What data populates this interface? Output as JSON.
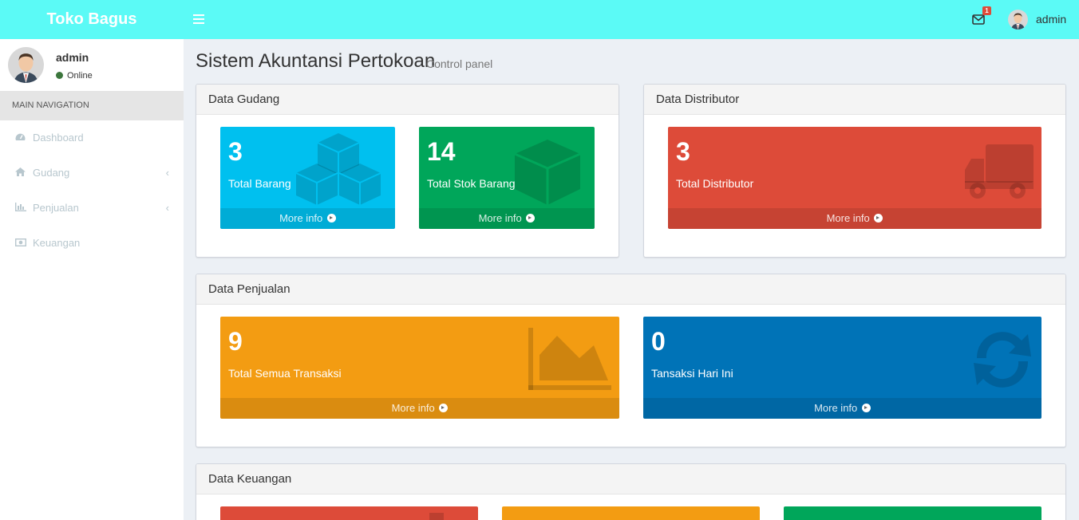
{
  "header": {
    "logo": "Toko Bagus",
    "mail_badge": "1",
    "username": "admin"
  },
  "sidebar": {
    "user": {
      "name": "admin",
      "status": "Online"
    },
    "nav_header": "MAIN NAVIGATION",
    "items": [
      {
        "label": "Dashboard",
        "icon": "dashboard-icon"
      },
      {
        "label": "Gudang",
        "icon": "home-icon",
        "has_children": true
      },
      {
        "label": "Penjualan",
        "icon": "bar-chart-icon",
        "has_children": true
      },
      {
        "label": "Keuangan",
        "icon": "money-icon"
      }
    ]
  },
  "page": {
    "title": "Sistem Akuntansi Pertokoan",
    "subtitle": "Control panel"
  },
  "sections": {
    "gudang": {
      "title": "Data Gudang",
      "boxes": [
        {
          "value": "3",
          "label": "Total Barang",
          "link": "More info",
          "icon": "cubes-icon"
        },
        {
          "value": "14",
          "label": "Total Stok Barang",
          "link": "More info",
          "icon": "cube-icon"
        }
      ]
    },
    "distributor": {
      "title": "Data Distributor",
      "boxes": [
        {
          "value": "3",
          "label": "Total Distributor",
          "link": "More info",
          "icon": "truck-icon"
        }
      ]
    },
    "penjualan": {
      "title": "Data Penjualan",
      "boxes": [
        {
          "value": "9",
          "label": "Total Semua Transaksi",
          "link": "More info",
          "icon": "area-chart-icon"
        },
        {
          "value": "0",
          "label": "Tansaksi Hari Ini",
          "link": "More info",
          "icon": "refresh-icon"
        }
      ]
    },
    "keuangan": {
      "title": "Data Keuangan"
    }
  },
  "colors": {
    "header": "#5bfaf6",
    "aqua": "#00c0ef",
    "green": "#00a65a",
    "red": "#dd4b39",
    "yellow": "#f39c12",
    "blue": "#0073b7"
  }
}
